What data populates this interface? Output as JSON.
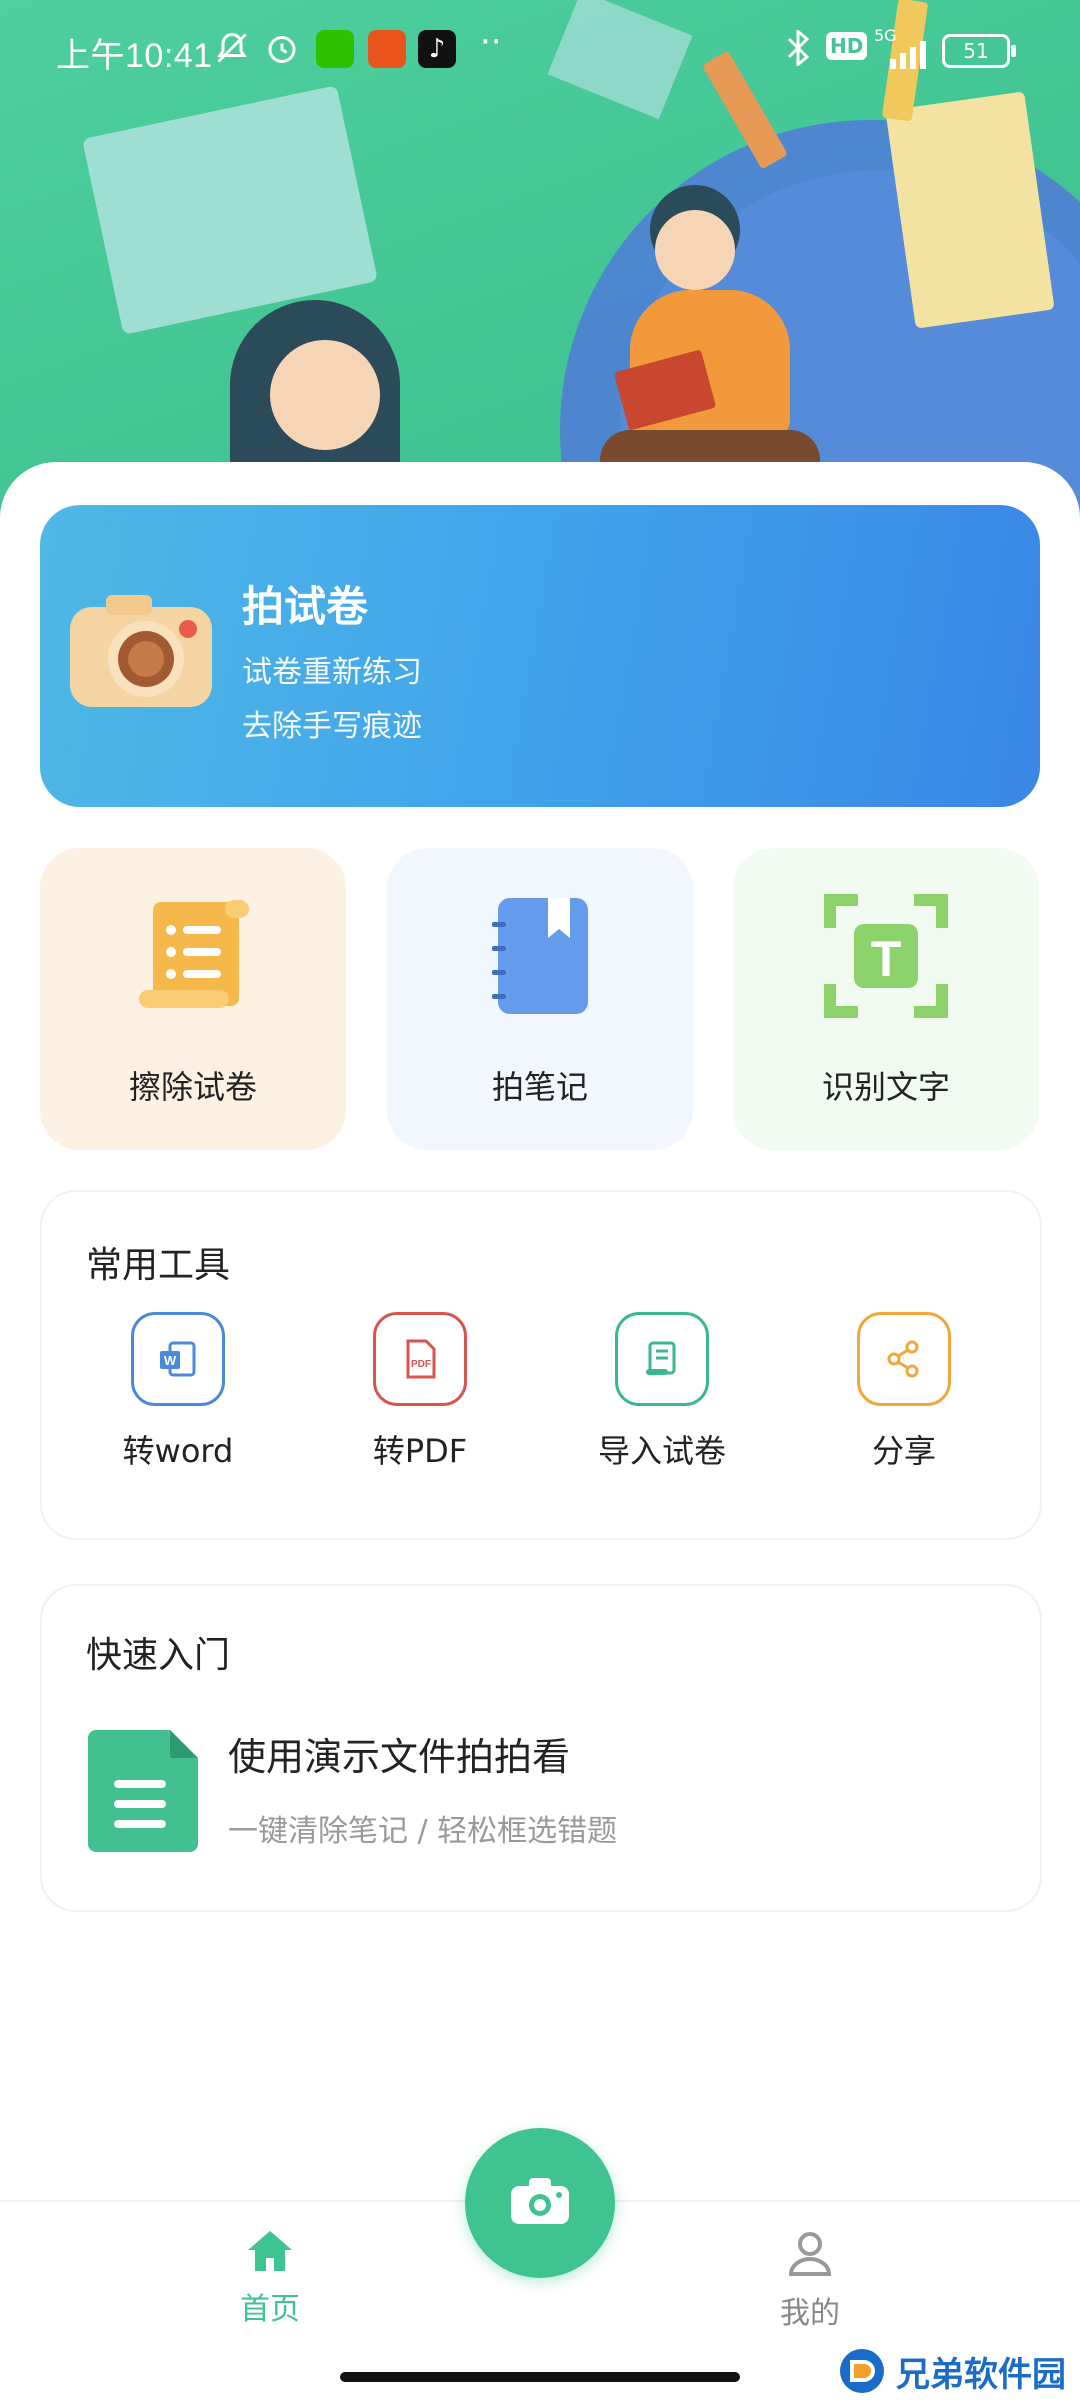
{
  "status_bar": {
    "time": "上午10:41",
    "network": "5G",
    "hd": "HD",
    "battery": "51"
  },
  "hero_card": {
    "title": "拍试卷",
    "line1": "试卷重新练习",
    "line2": "去除手写痕迹"
  },
  "features": [
    {
      "label": "擦除试卷"
    },
    {
      "label": "拍笔记"
    },
    {
      "label": "识别文字"
    }
  ],
  "tools": {
    "title": "常用工具",
    "items": [
      {
        "label": "转word",
        "icon": "word-icon",
        "color": "#4a8ad8"
      },
      {
        "label": "转PDF",
        "icon": "pdf-icon",
        "color": "#d9534f"
      },
      {
        "label": "导入试卷",
        "icon": "import-paper-icon",
        "color": "#3cb98b"
      },
      {
        "label": "分享",
        "icon": "share-icon",
        "color": "#f0a83a"
      }
    ]
  },
  "quick_start": {
    "title": "快速入门",
    "item_title": "使用演示文件拍拍看",
    "item_subtitle": "一键清除笔记 / 轻松框选错题"
  },
  "tabbar": {
    "home": "首页",
    "mine": "我的"
  },
  "watermark": "兄弟软件园",
  "colors": {
    "accent": "#3fc391",
    "card_blue": "#41a3ea"
  }
}
